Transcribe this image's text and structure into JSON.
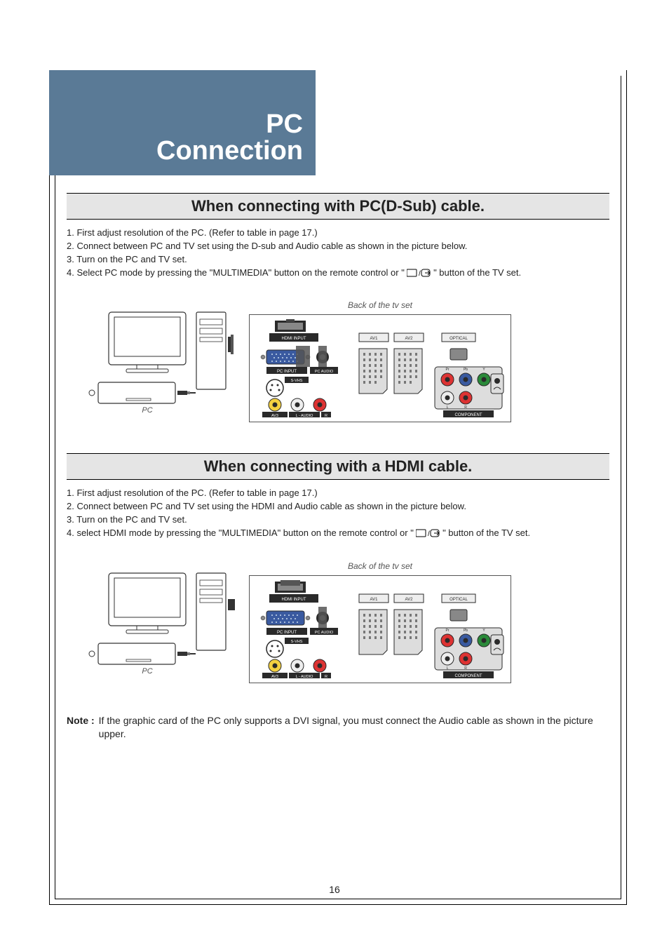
{
  "header": {
    "line1": "PC",
    "line2": "Connection"
  },
  "section1": {
    "title": "When connecting with PC(D-Sub) cable.",
    "steps": [
      "1. First adjust resolution of the PC. (Refer to table in page 17.)",
      "2. Connect between PC and TV set using the D-sub and Audio cable as shown in the picture below.",
      "3. Turn on the PC and TV set.",
      "4. Select PC mode by pressing the \"MULTIMEDIA\" button on the remote control or \"",
      "\" button of the TV set."
    ],
    "back_label": "Back of the tv set",
    "pc_label": "PC"
  },
  "section2": {
    "title": "When connecting with a HDMI cable.",
    "steps": [
      "1. First adjust resolution of the PC. (Refer to table in page 17.)",
      "2. Connect between PC and TV set using the HDMI and Audio cable as shown in the picture below.",
      "3. Turn on the PC and TV set.",
      "4. select HDMI mode by pressing the \"MULTIMEDIA\" button on the remote control or \"",
      "\" button of the TV set."
    ],
    "back_label": "Back of the tv set",
    "pc_label": "PC"
  },
  "note": {
    "label": "Note :",
    "text": "If the graphic card of the PC only supports a DVI signal, you must connect the Audio cable as shown in the picture upper."
  },
  "panel": {
    "hdmi": "HDMI INPUT",
    "av1": "AV1",
    "av2": "AV2",
    "optical": "OPTICAL",
    "pcinput": "PC INPUT",
    "pcaudio": "PC AUDIO",
    "svhs": "S-VHS",
    "av3": "AV3",
    "laudio": "L - AUDIO",
    "r": "R",
    "component": "COMPONENT",
    "pr": "Pr",
    "pb": "Pb",
    "y": "Y",
    "l": "L"
  },
  "page_number": "16"
}
